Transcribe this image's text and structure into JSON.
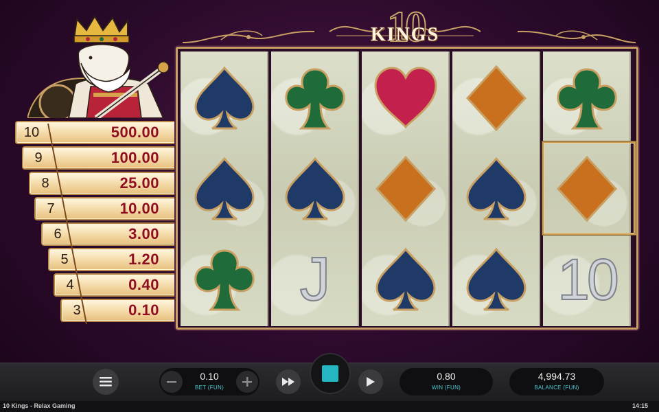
{
  "logo": {
    "number": "10",
    "word": "KINGS"
  },
  "paytable": [
    {
      "count": "10",
      "value": "500.00"
    },
    {
      "count": "9",
      "value": "100.00"
    },
    {
      "count": "8",
      "value": "25.00"
    },
    {
      "count": "7",
      "value": "10.00"
    },
    {
      "count": "6",
      "value": "3.00"
    },
    {
      "count": "5",
      "value": "1.20"
    },
    {
      "count": "4",
      "value": "0.40"
    },
    {
      "count": "3",
      "value": "0.10"
    }
  ],
  "reels": [
    [
      "spade",
      "spade",
      "club"
    ],
    [
      "club",
      "spade",
      "J"
    ],
    [
      "heart",
      "diamond",
      "spade"
    ],
    [
      "diamond",
      "spade",
      "spade"
    ],
    [
      "club",
      "diamond",
      "10"
    ]
  ],
  "controls": {
    "bet_value": "0.10",
    "bet_label": "BET (FUN)",
    "win_value": "0.80",
    "win_label": "WIN (FUN)",
    "balance_value": "4,994.73",
    "balance_label": "BALANCE (FUN)"
  },
  "footer": {
    "title": "10 Kings - Relax Gaming",
    "time": "14:15"
  },
  "colors": {
    "spade": "#1f3a66",
    "club": "#1f6b3a",
    "heart": "#c4204e",
    "diamond": "#c9701f",
    "accent": "#25b6c4",
    "pay_value": "#8e0f22"
  }
}
